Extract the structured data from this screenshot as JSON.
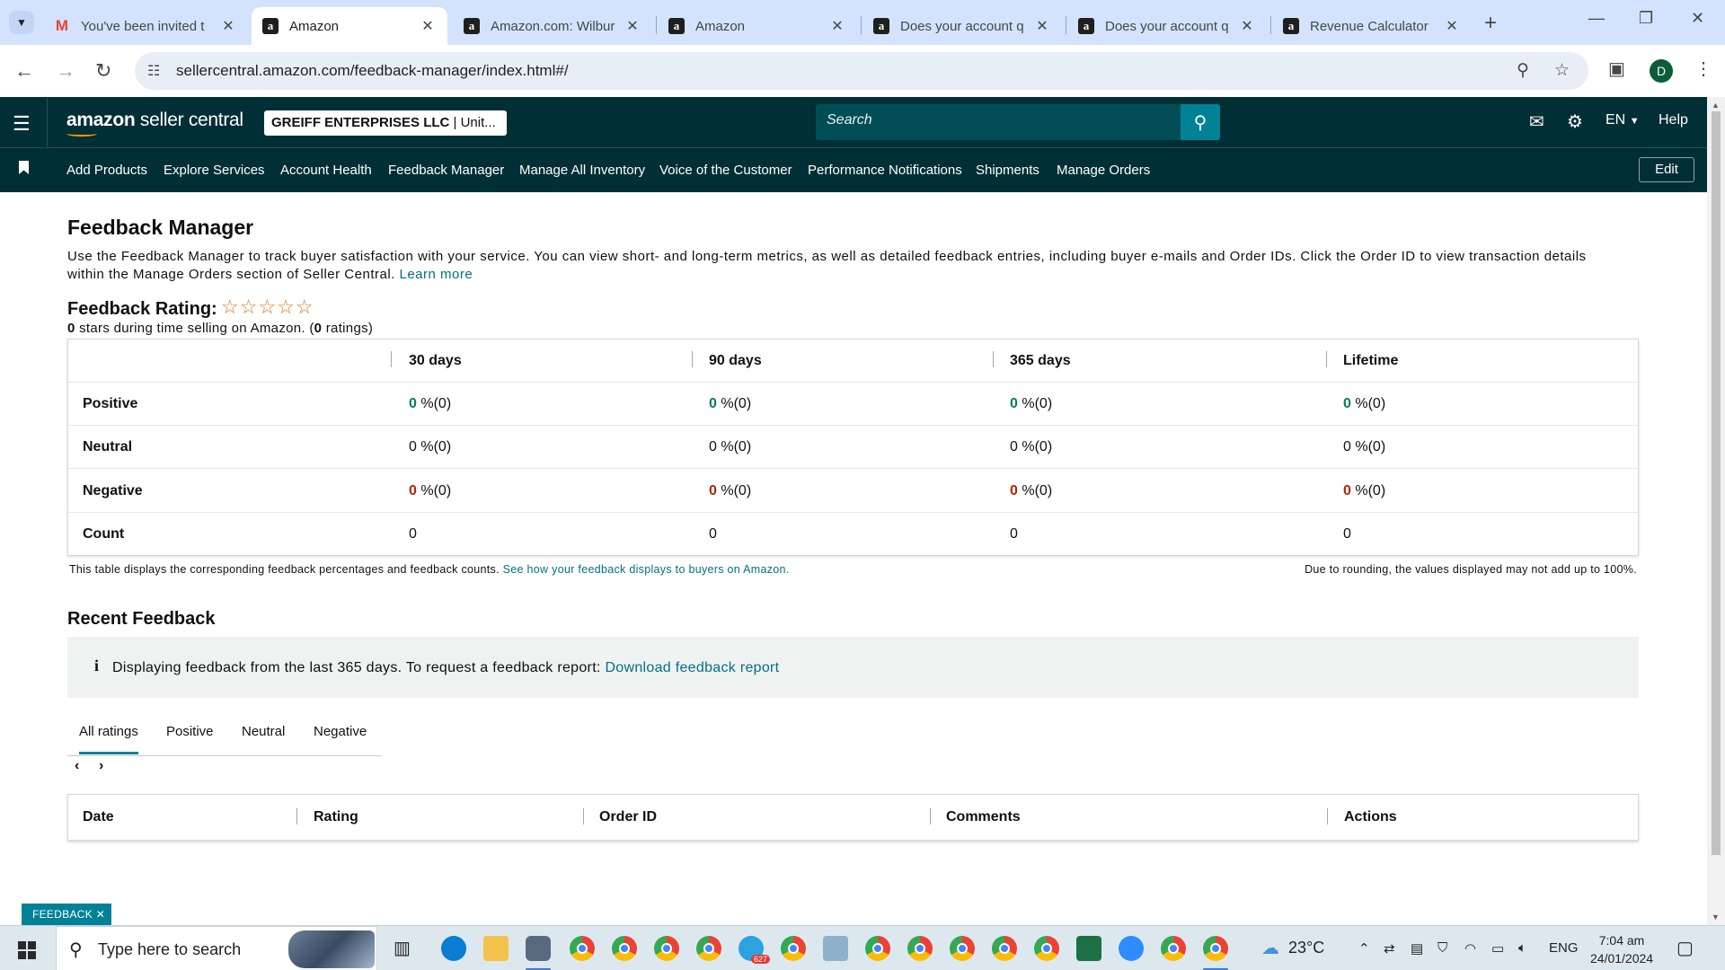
{
  "browser": {
    "tabs": [
      {
        "title": "You've been invited t",
        "icon": "gmail-icon",
        "active": false
      },
      {
        "title": "Amazon",
        "icon": "amazon-icon",
        "active": true
      },
      {
        "title": "Amazon.com: Wilbur",
        "icon": "amazon-icon",
        "active": false
      },
      {
        "title": "Amazon",
        "icon": "amazon-icon",
        "active": false
      },
      {
        "title": "Does your account q",
        "icon": "amazon-icon",
        "active": false
      },
      {
        "title": "Does your account q",
        "icon": "amazon-icon",
        "active": false
      },
      {
        "title": "Revenue Calculator",
        "icon": "amazon-icon",
        "active": false
      }
    ],
    "url": "sellercentral.amazon.com/feedback-manager/index.html#/",
    "profile_initial": "D"
  },
  "header": {
    "logo_brand": "amazon",
    "logo_suffix": " seller central",
    "account_name": "GREIFF ENTERPRISES LLC",
    "account_region": " | Unit...",
    "search_placeholder": "Search",
    "language": "EN",
    "help": "Help"
  },
  "nav": {
    "items": [
      "Add Products",
      "Explore Services",
      "Account Health",
      "Feedback Manager",
      "Manage All Inventory",
      "Voice of the Customer",
      "Performance Notifications",
      "Shipments",
      "Manage Orders"
    ],
    "edit": "Edit"
  },
  "page": {
    "title": "Feedback Manager",
    "description": "Use the Feedback Manager to track buyer satisfaction with your service. You can view short- and long-term metrics, as well as detailed feedback entries, including buyer e-mails and Order IDs. Click the Order ID to view transaction details within the Manage Orders section of Seller Central. ",
    "learn_more": "Learn more",
    "rating_title": "Feedback Rating:",
    "rating_stars": "☆☆☆☆☆",
    "rating_value": "0",
    "rating_sub_mid": " stars during time selling on Amazon. (",
    "rating_count": "0",
    "rating_sub_end": " ratings)"
  },
  "feedback_table": {
    "headers": [
      "30 days",
      "90 days",
      "365 days",
      "Lifetime"
    ],
    "rows": [
      {
        "label": "Positive",
        "values": [
          "0",
          "0",
          "0",
          "0"
        ],
        "counts": [
          "%(0)",
          "%(0)",
          "%(0)",
          "%(0)"
        ],
        "color": "#067d62"
      },
      {
        "label": "Neutral",
        "values": [
          "0",
          "0",
          "0",
          "0"
        ],
        "counts": [
          "%(0)",
          "%(0)",
          "%(0)",
          "%(0)"
        ],
        "color": "#0f1111"
      },
      {
        "label": "Negative",
        "values": [
          "0",
          "0",
          "0",
          "0"
        ],
        "counts": [
          "%(0)",
          "%(0)",
          "%(0)",
          "%(0)"
        ],
        "color": "#b12704"
      },
      {
        "label": "Count",
        "values": [
          "0",
          "0",
          "0",
          "0"
        ]
      }
    ],
    "note": "This table displays the corresponding feedback percentages and feedback counts. ",
    "note_link": "See how your feedback displays to buyers on Amazon.",
    "rounding_note": "Due to rounding, the values displayed may not add up to 100%."
  },
  "recent": {
    "title": "Recent Feedback",
    "info": "Displaying feedback from the last 365 days. To request a feedback report: ",
    "info_link": "Download feedback report",
    "tabs": [
      "All ratings",
      "Positive",
      "Neutral",
      "Negative"
    ],
    "columns": [
      "Date",
      "Rating",
      "Order ID",
      "Comments",
      "Actions"
    ]
  },
  "feedback_button": "FEEDBACK",
  "taskbar": {
    "search_placeholder": "Type here to search",
    "temperature": "23°C",
    "language": "ENG",
    "time": "7:04 am",
    "date": "24/01/2024",
    "telegram_badge": "627"
  },
  "colors": {
    "header_bg": "#002f36",
    "search_button": "#008296",
    "link": "#007185",
    "positive": "#067d62",
    "negative": "#b12704",
    "star": "#de7921"
  }
}
